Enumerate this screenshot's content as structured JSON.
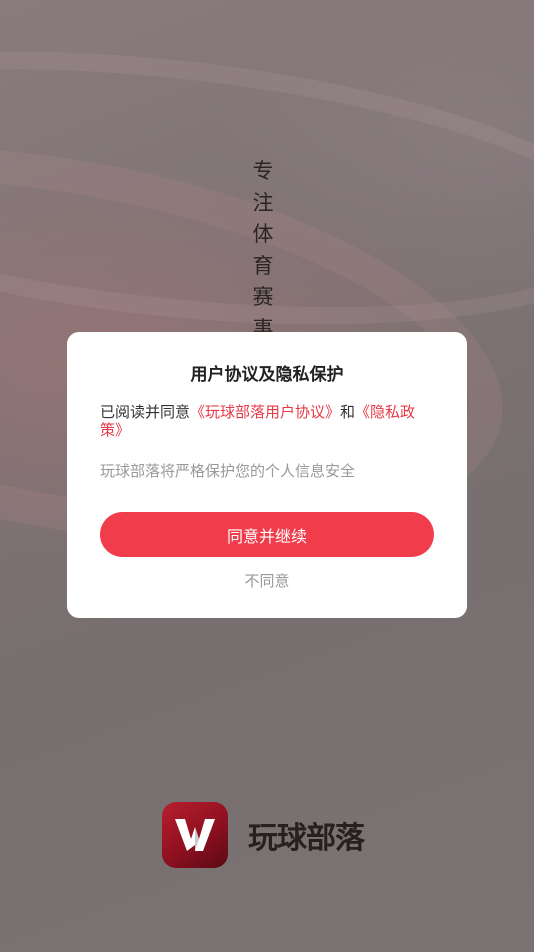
{
  "splash": {
    "slogan_chars": [
      "专",
      "注",
      "体",
      "育",
      "赛",
      "事"
    ],
    "brand_name": "玩球部落",
    "logo_icon": "brand-w-logo-icon"
  },
  "dialog": {
    "title": "用户协议及隐私保护",
    "agree_prefix": "已阅读并同意",
    "user_agreement_link": "《玩球部落用户协议》",
    "conjunction": "和",
    "privacy_policy_link": "《隐私政策》",
    "info_text": "玩球部落将严格保护您的个人信息安全",
    "agree_button_label": "同意并继续",
    "disagree_button_label": "不同意"
  },
  "colors": {
    "accent": "#f13c4b",
    "link": "#e63946",
    "overlay": "#7a6d6e"
  }
}
